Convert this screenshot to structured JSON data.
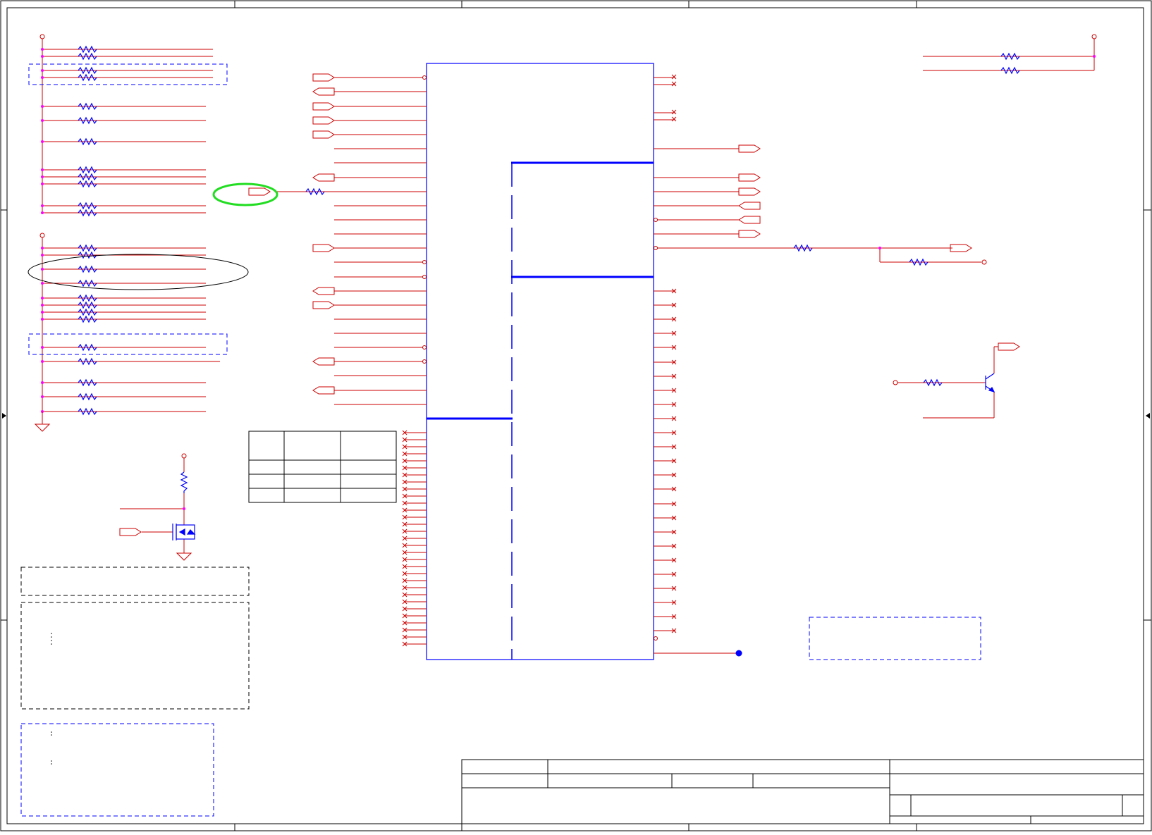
{
  "colors": {
    "wire": "#cc0000",
    "bus": "#0000cc",
    "part": "#0000ff",
    "junction": "#ff00ff",
    "highlight_green": "#22dd22",
    "border": "#000000"
  },
  "schematic": {
    "chip_label": "",
    "title_block": {
      "title": "",
      "company": "",
      "drawing_number": "",
      "revision": "",
      "size": "",
      "date": "",
      "sheet": ""
    },
    "notes": {
      "note_1": "",
      "note_2": "",
      "note_3": ""
    },
    "config_table": {
      "headers": [
        "",
        "",
        ""
      ],
      "rows": [
        [
          "",
          "",
          ""
        ],
        [
          "",
          "",
          ""
        ],
        [
          "",
          "",
          ""
        ]
      ]
    }
  }
}
